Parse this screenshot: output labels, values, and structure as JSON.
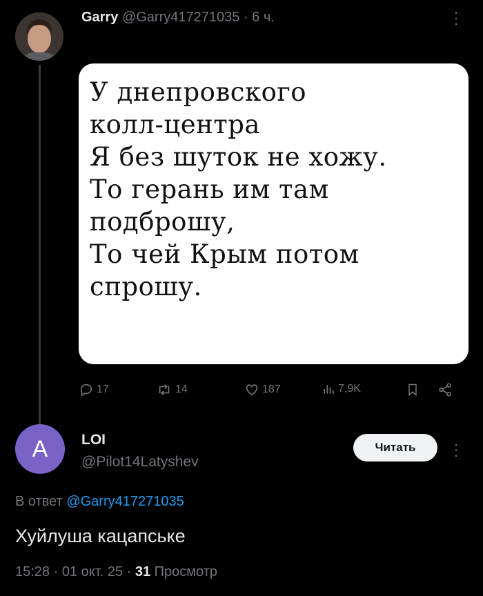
{
  "post": {
    "author_name": "Garry",
    "author_handle": "@Garry417271035",
    "time": "6 ч.",
    "image_text": "У днепровского\nколл-центра\nЯ без шуток не хожу.\nТо герань им там\nподброшу,\nТо чей Крым потом\nспрошу.",
    "actions": {
      "replies": "17",
      "reposts": "14",
      "likes": "187",
      "views": "7,9K"
    },
    "icons": [
      "more-icon",
      "reply-icon",
      "repost-icon",
      "like-icon",
      "views-icon",
      "bookmark-icon",
      "share-icon"
    ]
  },
  "reply": {
    "avatar_letter": "A",
    "author_name": "LOI",
    "author_handle": "@Pilot14Latyshev",
    "follow_label": "Читать",
    "reply_to_prefix": "В ответ",
    "reply_to_handle": "@Garry417271035",
    "text": "Хуйлуша кацапське",
    "time": "15:28",
    "date": "01 окт. 25",
    "views_count": "31",
    "views_label": "Просмотр"
  },
  "colors": {
    "background": "#000000",
    "text": "#e7e9ea",
    "muted": "#71767b",
    "link": "#1d9bf0",
    "avatar": "#7a63c7"
  }
}
